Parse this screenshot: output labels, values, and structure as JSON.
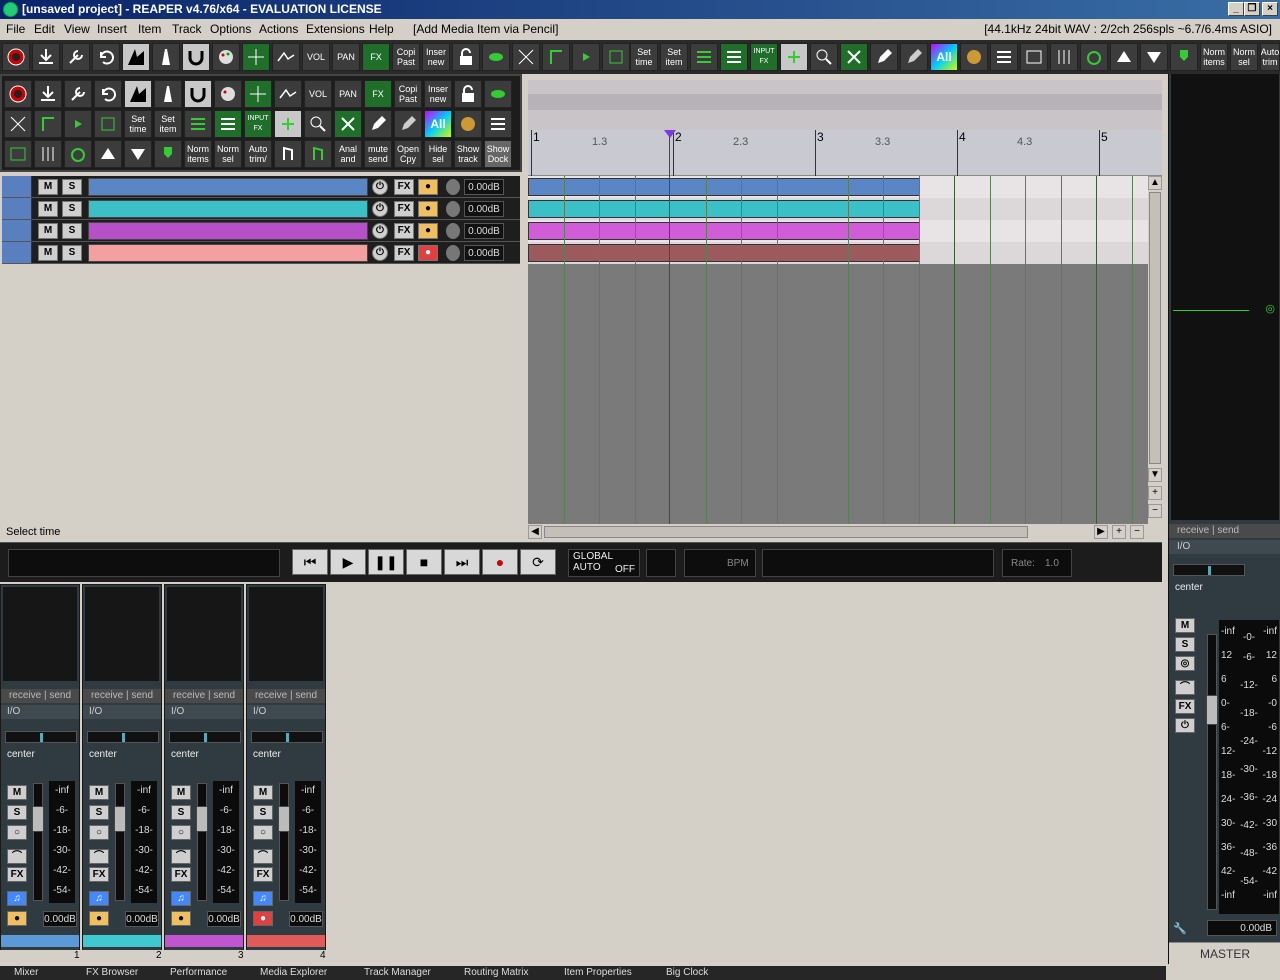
{
  "window": {
    "title": "[unsaved project] - REAPER v4.76/x64 - EVALUATION LICENSE"
  },
  "menu": {
    "items": [
      "File",
      "Edit",
      "View",
      "Insert",
      "Item",
      "Track",
      "Options",
      "Actions",
      "Extensions",
      "Help",
      "[Add Media Item via Pencil]"
    ],
    "audio_info": "[44.1kHz 24bit WAV : 2/2ch 256spls ~6.7/6.4ms ASIO]"
  },
  "toolbar": {
    "copi_past": [
      "Copi",
      "Past"
    ],
    "inser_new": [
      "Inser",
      "new"
    ],
    "set_time": [
      "Set",
      "time"
    ],
    "set_item": [
      "Set",
      "item"
    ],
    "input_fx": "INPUT FX",
    "all": "All",
    "norm_items": [
      "Norm",
      "items"
    ],
    "norm_sel": [
      "Norm",
      "sel"
    ],
    "auto_trim": [
      "Auto",
      "trim"
    ],
    "auto_trim_dock": [
      "Auto",
      "trim/"
    ],
    "anal_and": [
      "Anal",
      "and"
    ],
    "mute_send": [
      "mute",
      "send"
    ],
    "open_cpy": [
      "Open",
      "Cpy"
    ],
    "hide_sel": [
      "Hide",
      "sel"
    ],
    "show_track": [
      "Show",
      "track"
    ],
    "show_dock": [
      "Show",
      "Dock"
    ],
    "vol": "VOL",
    "pan": "PAN",
    "fx": "FX"
  },
  "tracks": [
    {
      "color": "#5a86c5",
      "volume": "0.00dB",
      "mute": "M",
      "solo": "S",
      "fx": "FX",
      "armed": false
    },
    {
      "color": "#3cc0c8",
      "volume": "0.00dB",
      "mute": "M",
      "solo": "S",
      "fx": "FX",
      "armed": false
    },
    {
      "color": "#b550c8",
      "volume": "0.00dB",
      "mute": "M",
      "solo": "S",
      "fx": "FX",
      "armed": false
    },
    {
      "color": "#f5a0a0",
      "volume": "0.00dB",
      "mute": "M",
      "solo": "S",
      "fx": "FX",
      "armed": true
    }
  ],
  "items": [
    {
      "color": "#5a86c5"
    },
    {
      "color": "#3cc0c8"
    },
    {
      "color": "#d05cd8"
    },
    {
      "color": "#9c5a5e"
    }
  ],
  "ruler": {
    "major": [
      "1",
      "2",
      "3",
      "4",
      "5"
    ],
    "minor": [
      "1.3",
      "2.3",
      "3.3",
      "4.3"
    ]
  },
  "status": {
    "text": "Select time"
  },
  "transport": {
    "global_auto": "GLOBAL AUTO",
    "global_auto_state": "OFF",
    "bpm_label": "BPM",
    "rate_label": "Rate:",
    "rate_value": "1.0"
  },
  "mixer": {
    "receive_send": "receive | send",
    "io": "I/O",
    "pan_label": "center",
    "scale": [
      "-inf",
      "-6-",
      "-18-",
      "-30-",
      "-42-",
      "-54-"
    ],
    "strips": [
      {
        "num": "1",
        "volume": "0.00dB",
        "color": "#5a9ad6"
      },
      {
        "num": "2",
        "volume": "0.00dB",
        "color": "#40c8d0"
      },
      {
        "num": "3",
        "volume": "0.00dB",
        "color": "#c055d0"
      },
      {
        "num": "4",
        "volume": "0.00dB",
        "color": "#e05a5a"
      }
    ]
  },
  "master": {
    "label": "MASTER",
    "receive_send": "receive | send",
    "io": "I/O",
    "pan_label": "center",
    "volume": "0.00dB",
    "scale_left": [
      "-inf",
      "-0-",
      "12",
      "6",
      "0-",
      "6-",
      "12-",
      "18-",
      "24-",
      "30-",
      "36-",
      "42-",
      "-inf"
    ],
    "scale_mid": [
      "-6-",
      "-12-",
      "-18-",
      "-24-",
      "-30-",
      "-36-",
      "-42-",
      "-48-",
      "-54-"
    ],
    "scale_right": [
      "-inf",
      "12",
      "6",
      "-0",
      "-6",
      "-12",
      "-18",
      "-24",
      "-30",
      "-36",
      "-42",
      "-inf"
    ]
  },
  "dock_tabs": [
    "Mixer",
    "FX Browser",
    "Performance",
    "Media Explorer",
    "Track Manager",
    "Routing Matrix",
    "Item Properties",
    "Big Clock"
  ]
}
